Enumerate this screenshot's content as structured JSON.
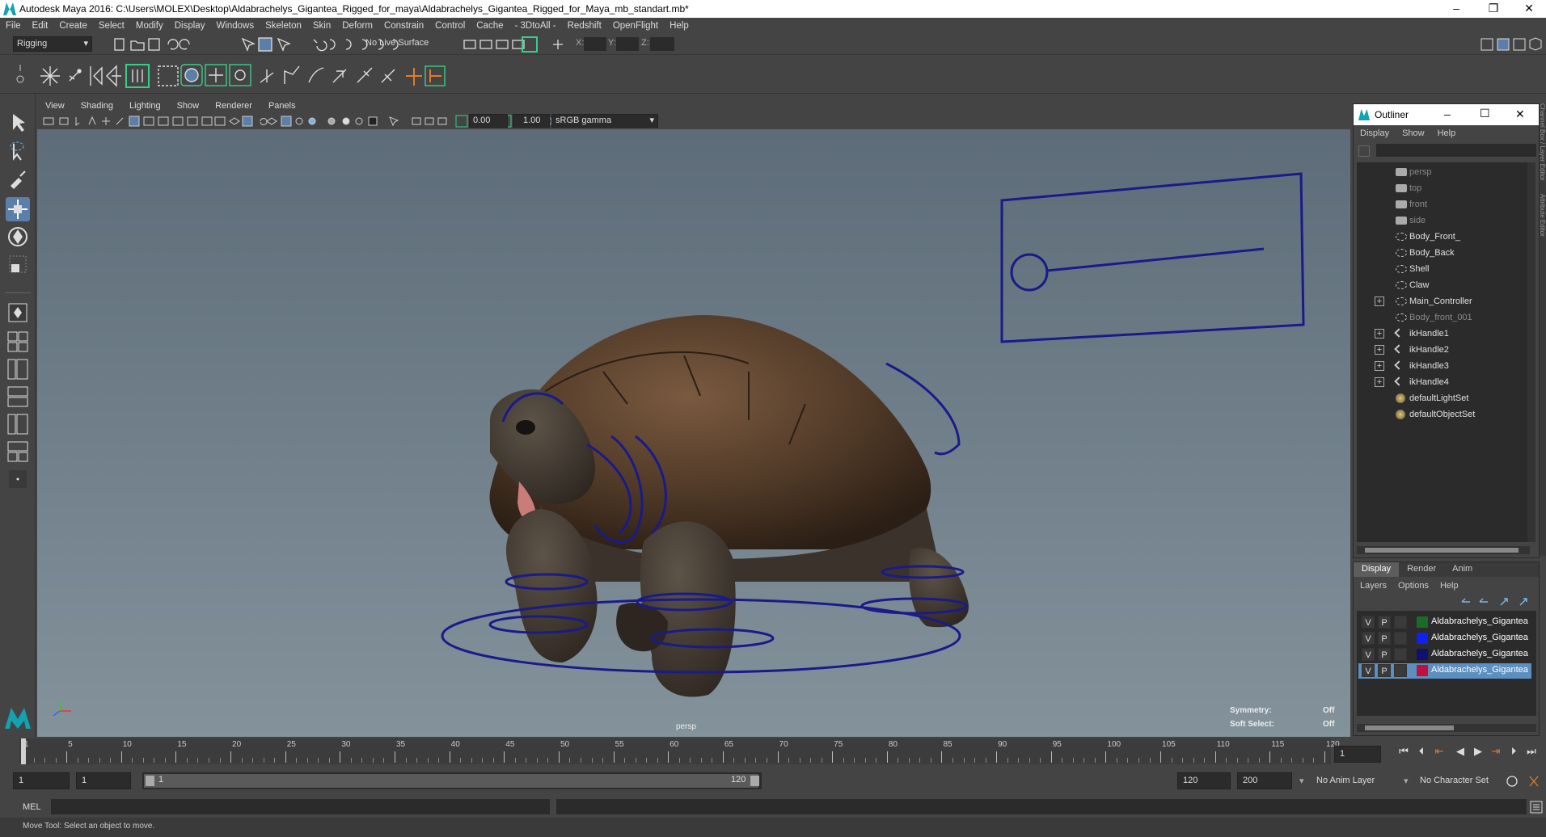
{
  "window": {
    "title": "Autodesk Maya 2016: C:\\Users\\MOLEX\\Desktop\\Aldabrachelys_Gigantea_Rigged_for_maya\\Aldabrachelys_Gigantea_Rigged_for_Maya_mb_standart.mb*",
    "minimize": "–",
    "restore": "❐",
    "close": "✕"
  },
  "menubar": [
    "File",
    "Edit",
    "Create",
    "Select",
    "Modify",
    "Display",
    "Windows",
    "Skeleton",
    "Skin",
    "Deform",
    "Constrain",
    "Control",
    "Cache",
    "- 3DtoAll -",
    "Redshift",
    "OpenFlight",
    "Help"
  ],
  "statusline": {
    "menuset": "Rigging",
    "live_surface": "No Live Surface",
    "x_label": "X:",
    "y_label": "Y:",
    "z_label": "Z:"
  },
  "viewport": {
    "menu": [
      "View",
      "Shading",
      "Lighting",
      "Show",
      "Renderer",
      "Panels"
    ],
    "exposure": "0.00",
    "gamma": "1.00",
    "color_space": "sRGB gamma",
    "camera_label": "persp",
    "symmetry_label": "Symmetry:",
    "symmetry_value": "Off",
    "soft_select_label": "Soft Select:",
    "soft_select_value": "Off"
  },
  "outliner": {
    "title": "Outliner",
    "minimize": "–",
    "maximize": "☐",
    "close": "✕",
    "menu": [
      "Display",
      "Show",
      "Help"
    ],
    "items": [
      {
        "label": "persp",
        "type": "camera",
        "dim": true,
        "expand": false
      },
      {
        "label": "top",
        "type": "camera",
        "dim": true,
        "expand": false
      },
      {
        "label": "front",
        "type": "camera",
        "dim": true,
        "expand": false
      },
      {
        "label": "side",
        "type": "camera",
        "dim": true,
        "expand": false
      },
      {
        "label": "Body_Front_",
        "type": "transform",
        "dim": false,
        "expand": false
      },
      {
        "label": "Body_Back",
        "type": "transform",
        "dim": false,
        "expand": false
      },
      {
        "label": "Shell",
        "type": "transform",
        "dim": false,
        "expand": false
      },
      {
        "label": "Claw",
        "type": "transform",
        "dim": false,
        "expand": false
      },
      {
        "label": "Main_Controller",
        "type": "transform",
        "dim": false,
        "expand": true
      },
      {
        "label": "Body_front_001",
        "type": "transform",
        "dim": true,
        "expand": false
      },
      {
        "label": "ikHandle1",
        "type": "ik",
        "dim": false,
        "expand": true
      },
      {
        "label": "ikHandle2",
        "type": "ik",
        "dim": false,
        "expand": true
      },
      {
        "label": "ikHandle3",
        "type": "ik",
        "dim": false,
        "expand": true
      },
      {
        "label": "ikHandle4",
        "type": "ik",
        "dim": false,
        "expand": true
      },
      {
        "label": "defaultLightSet",
        "type": "set",
        "dim": false,
        "expand": false
      },
      {
        "label": "defaultObjectSet",
        "type": "set",
        "dim": false,
        "expand": false
      }
    ]
  },
  "layer_editor": {
    "tabs": [
      "Display",
      "Render",
      "Anim"
    ],
    "menu": [
      "Layers",
      "Options",
      "Help"
    ],
    "layers": [
      {
        "v": "V",
        "p": "P",
        "color": "#1a6a2a",
        "name": "Aldabrachelys_Gigantea",
        "selected": false
      },
      {
        "v": "V",
        "p": "P",
        "color": "#1020f0",
        "name": "Aldabrachelys_Gigantea",
        "selected": false
      },
      {
        "v": "V",
        "p": "P",
        "color": "#101070",
        "name": "Aldabrachelys_Gigantea",
        "selected": false
      },
      {
        "v": "V",
        "p": "P",
        "color": "#c01040",
        "name": "Aldabrachelys_Gigantea",
        "selected": true
      }
    ]
  },
  "time_slider": {
    "ticks": [
      "1",
      "5",
      "10",
      "15",
      "20",
      "25",
      "30",
      "35",
      "40",
      "45",
      "50",
      "55",
      "60",
      "65",
      "70",
      "75",
      "80",
      "85",
      "90",
      "95",
      "100",
      "105",
      "110",
      "115",
      "120"
    ],
    "current_frame": "1"
  },
  "range_slider": {
    "start": "1",
    "range_start": "1",
    "bar_start": "1",
    "bar_end": "120",
    "range_end": "120",
    "end": "200",
    "anim_layer": "No Anim Layer",
    "character_set": "No Character Set"
  },
  "command_line": {
    "label": "MEL"
  },
  "help_line": {
    "text": "Move Tool: Select an object to move."
  },
  "side_tabs": [
    "Channel Box / Layer Editor",
    "Attribute Editor"
  ]
}
